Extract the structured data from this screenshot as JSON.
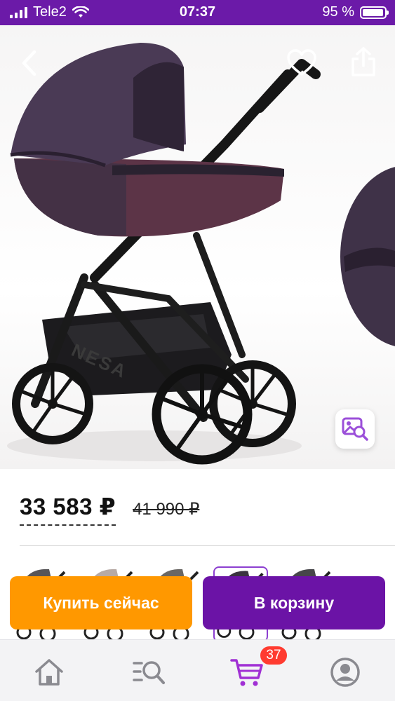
{
  "status_bar": {
    "carrier": "Tele2",
    "time": "07:37",
    "battery": "95 %",
    "battery_level_percent": 95
  },
  "gallery": {
    "back_icon": "chevron-left-icon",
    "favorite_icon": "heart-outline-icon",
    "share_icon": "share-icon",
    "visual_search_icon": "image-search-icon",
    "photo_text": "NESA"
  },
  "price": {
    "current": "33 583 ₽",
    "old": "41 990 ₽"
  },
  "variants": {
    "count_visible": 5,
    "selected_index": 3
  },
  "actions": {
    "buy_now": "Купить сейчас",
    "add_to_cart": "В корзину"
  },
  "tab_bar": {
    "items": [
      {
        "icon": "home-icon"
      },
      {
        "icon": "catalog-search-icon"
      },
      {
        "icon": "cart-icon"
      },
      {
        "icon": "profile-icon"
      }
    ],
    "cart_badge": "37"
  },
  "colors": {
    "brand_purple": "#6b1aa8",
    "buy_orange": "#ff9800",
    "cart_purple": "#6b13a6",
    "badge_red": "#ff3b30"
  }
}
